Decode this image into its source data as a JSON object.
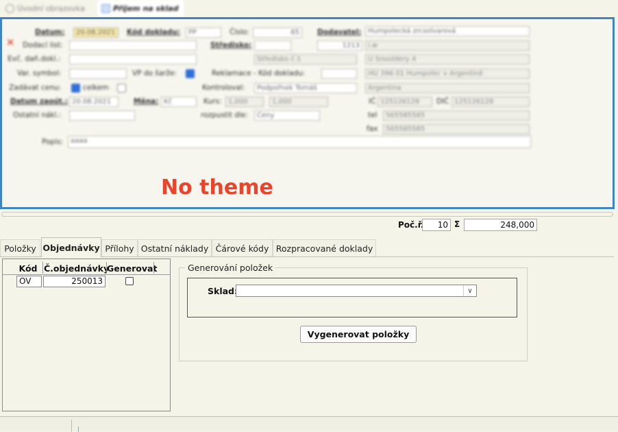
{
  "window_tabs": [
    {
      "label": "Úvodní obrazovka"
    },
    {
      "label": "Příjem na sklad"
    }
  ],
  "header": {
    "watermark": "No theme",
    "labels": {
      "datum": "Datum:",
      "kod_dokladu": "Kód dokladu:",
      "cislo": "Číslo:",
      "dodavatel": "Dodavatel:",
      "dodaci_list": "Dodací list:",
      "stredisko": "Středisko:",
      "evc_dan_dokl": "Evč. daň.dokl.:",
      "var_symbol": "Var. symbol:",
      "vp_do_sarze": "VP do šarže:",
      "reklamace": "Reklamace - Kód dokladu:",
      "zadavat_cenu": "Zadávat cenu:",
      "celkem": "celkem",
      "kontroloval": "Kontroloval:",
      "datum_zaout": "Datum zaoút.:",
      "mena": "Měna:",
      "kurs": "Kurs:",
      "ostatni_nakl": "Ostatní nákl.:",
      "rozpustit_dle": "rozpustit dle:",
      "ic": "IČ",
      "dic": "DIČ",
      "tel": "tel",
      "fax": "fax",
      "popis": "Popis:"
    },
    "values": {
      "datum": "20.08.2021",
      "kod_dokladu": "PP",
      "cislo": "65",
      "dodavatel": "Humpolecká zrcsolvarová",
      "stredisko_num": "1213",
      "stredisko_name": "Středisko č.1",
      "addr_1": "i.w",
      "addr_2": "U Snooldery 4",
      "addr_3": "HU 396 01 Humpolec v Argentině",
      "addr_4": "Argentina",
      "kontroloval": "Podpořnek Tomáš",
      "datum_zaout": "20.08.2021",
      "mena": "Kč",
      "kurs": "1,000",
      "kurs_2": "1,000",
      "rozpustit_dle": "Ceny",
      "ic": "125126128",
      "dic": "125126128",
      "tel": "565585585",
      "fax": "565585585",
      "popis": "aaaa"
    }
  },
  "summary": {
    "poc_r_label": "Poč.ř.",
    "poc_r_value": "10",
    "sigma_label": "Σ",
    "sigma_value": "248,000"
  },
  "tabs": [
    {
      "label": "Položky"
    },
    {
      "label": "Objednávky"
    },
    {
      "label": "Přílohy"
    },
    {
      "label": "Ostatní náklady"
    },
    {
      "label": "Čárové kódy"
    },
    {
      "label": "Rozpracované doklady"
    }
  ],
  "active_tab": "Objednávky",
  "grid": {
    "columns": [
      "Kód",
      "Č.objednávky",
      "Generovat"
    ],
    "rows": [
      {
        "kod": "OV",
        "cislo": "250013",
        "generovat": false
      }
    ]
  },
  "generation": {
    "legend": "Generování položek",
    "sklad_label": "Sklad:",
    "sklad_value": "",
    "button_label": "Vygenerovat položky"
  }
}
